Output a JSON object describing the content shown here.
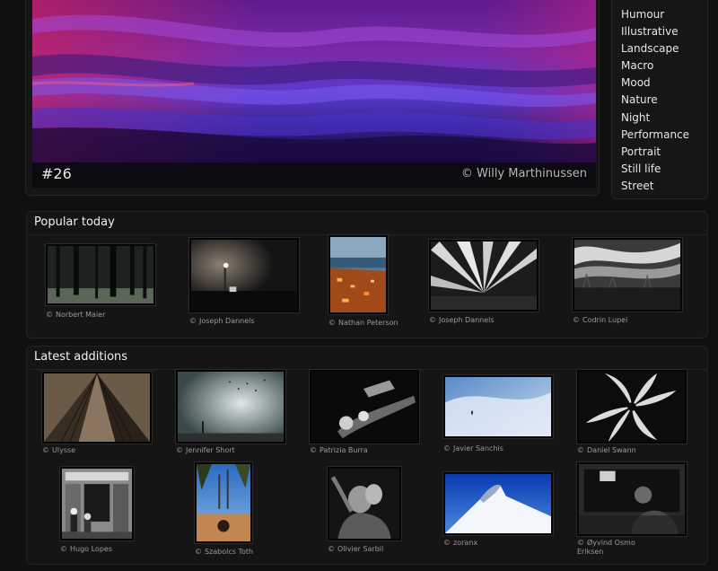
{
  "featured": {
    "number": "#26",
    "credit": "© Willy Marthinussen"
  },
  "categories": [
    "Humour",
    "Illustrative",
    "Landscape",
    "Macro",
    "Mood",
    "Nature",
    "Night",
    "Performance",
    "Portrait",
    "Still life",
    "Street"
  ],
  "popular": {
    "title": "Popular today",
    "photos": [
      {
        "photographer": "Norbert Maier"
      },
      {
        "photographer": "Joseph Dannels"
      },
      {
        "photographer": "Nathan Peterson"
      },
      {
        "photographer": "Joseph Dannels"
      },
      {
        "photographer": "Codrin Lupei"
      }
    ]
  },
  "latest": {
    "title": "Latest additions",
    "photos": [
      {
        "photographer": "Ulysse"
      },
      {
        "photographer": "Jennifer Short"
      },
      {
        "photographer": "Patrizia Burra"
      },
      {
        "photographer": "Javier Sanchis"
      },
      {
        "photographer": "Daniel Swann"
      },
      {
        "photographer": "Hugo Lopes"
      },
      {
        "photographer": "Szabolcs Toth"
      },
      {
        "photographer": "Olivier Sarbil"
      },
      {
        "photographer": "zoranx"
      },
      {
        "photographer": "Øyvind Osmo Eriksen"
      }
    ]
  },
  "copyright_symbol": "©"
}
